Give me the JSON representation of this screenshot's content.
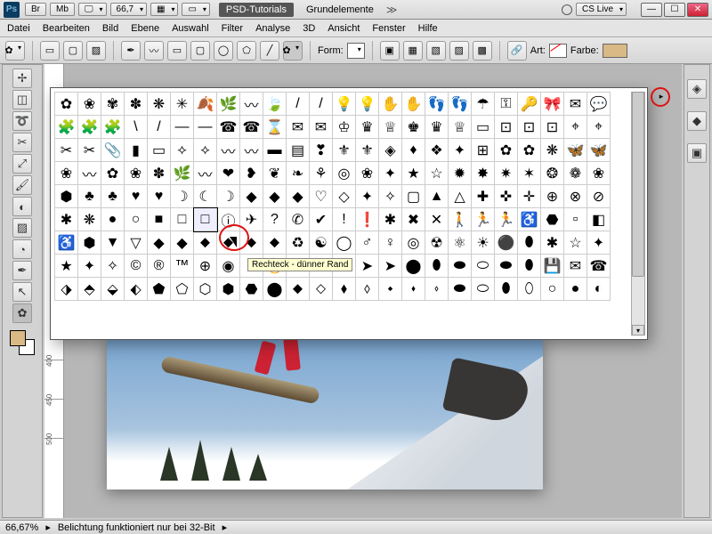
{
  "titlebar": {
    "zoom": "66,7",
    "tab1": "PSD-Tutorials",
    "tab2": "Grundelemente",
    "cs_live": "CS Live"
  },
  "menu": [
    "Datei",
    "Bearbeiten",
    "Bild",
    "Ebene",
    "Auswahl",
    "Filter",
    "Analyse",
    "3D",
    "Ansicht",
    "Fenster",
    "Hilfe"
  ],
  "optbar": {
    "form_label": "Form:",
    "art_label": "Art:",
    "farbe_label": "Farbe:",
    "farbe_hex": "#d9b985"
  },
  "tooltip": "Rechteck - dünner Rand",
  "status": {
    "zoom": "66,67%",
    "info": "Belichtung funktioniert nur bei 32-Bit"
  },
  "ruler_labels": [
    "400",
    "450",
    "500"
  ],
  "shapes": [
    [
      "✿",
      "❀",
      "✾",
      "✽",
      "❋",
      "✳",
      "🍂",
      "🌿",
      "〰",
      "🍃",
      "/",
      "/",
      "💡",
      "💡",
      "✋",
      "✋",
      "👣",
      "👣",
      "☂",
      "⚿",
      "🔑",
      "🎀",
      "✉",
      "💬"
    ],
    [
      "🧩",
      "🧩",
      "🧩",
      "\\",
      "/",
      "—",
      "—",
      "☎",
      "☎",
      "⌛",
      "✉",
      "✉",
      "♔",
      "♛",
      "♕",
      "♚",
      "♛",
      "♕",
      "▭",
      "⊡",
      "⊡",
      "⊡",
      "⌖",
      "⌖"
    ],
    [
      "✂",
      "✂",
      "📎",
      "▮",
      "▭",
      "⟡",
      "⟡",
      "〰",
      "〰",
      "▬",
      "▤",
      "❣",
      "⚜",
      "⚜",
      "◈",
      "♦",
      "❖",
      "✦",
      "⊞",
      "✿",
      "✿",
      "❋",
      "🦋",
      "🦋"
    ],
    [
      "❀",
      "〰",
      "✿",
      "❀",
      "✽",
      "🌿",
      "〰",
      "❤",
      "❥",
      "❦",
      "❧",
      "⚘",
      "◎",
      "❀",
      "✦",
      "★",
      "☆",
      "✹",
      "✸",
      "✷",
      "✶",
      "❂",
      "❁",
      "❀"
    ],
    [
      "⬢",
      "♣",
      "♣",
      "♥",
      "♥",
      "☽",
      "☾",
      "☽",
      "◆",
      "◆",
      "◆",
      "♡",
      "◇",
      "✦",
      "✧",
      "▢",
      "▲",
      "△",
      "✚",
      "✜",
      "✛",
      "⊕",
      "⊗",
      "⊘"
    ],
    [
      "✱",
      "❋",
      "●",
      "○",
      "■",
      "□",
      "□",
      "ⓘ",
      "✈",
      "?",
      "✆",
      "✔",
      "!",
      "❗",
      "✱",
      "✖",
      "✕",
      "🚶",
      "🏃",
      "🏃",
      "♿",
      "⬣",
      "▫",
      "◧"
    ],
    [
      "♿",
      "⬢",
      "▼",
      "▽",
      "◆",
      "◆",
      "⬥",
      "⬥",
      "⬥",
      "⬥",
      "♻",
      "☯",
      "◯",
      "♂",
      "♀",
      "◎",
      "☢",
      "⚛",
      "☀",
      "⚫",
      "⬮",
      "✱",
      "☆",
      "✦"
    ],
    [
      "★",
      "✦",
      "✧",
      "©",
      "®",
      "™",
      "⊕",
      "◉",
      "ℹ",
      "🔥",
      "⊘",
      "↖",
      "⬉",
      "➤",
      "➤",
      "⬤",
      "⬮",
      "⬬",
      "⬭",
      "⬬",
      "⬮",
      "💾",
      "✉",
      "☎"
    ],
    [
      "⬗",
      "⬘",
      "⬙",
      "⬖",
      "⬟",
      "⬠",
      "⬡",
      "⬢",
      "⬣",
      "⬤",
      "⬥",
      "⬦",
      "⬧",
      "⬨",
      "⬩",
      "⬪",
      "⬫",
      "⬬",
      "⬭",
      "⬮",
      "⬯",
      "○",
      "●",
      "◐"
    ]
  ],
  "selected_shape": {
    "row": 5,
    "col": 6
  },
  "chart_data": {
    "type": "table",
    "note": "no chart data; application UI screenshot"
  }
}
